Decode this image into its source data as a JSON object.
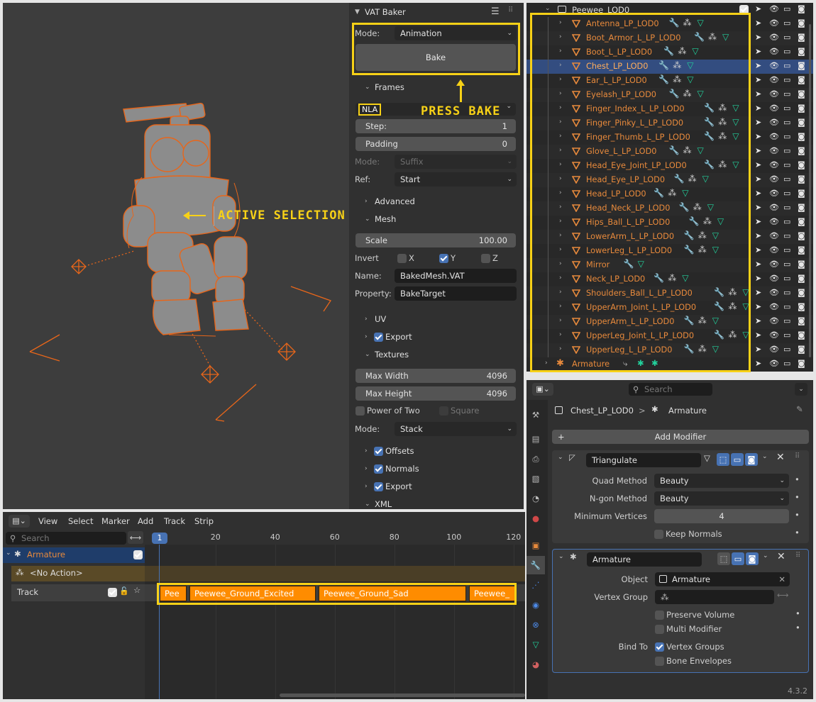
{
  "vat_baker": {
    "title": "VAT Baker",
    "mode_label": "Mode:",
    "mode_value": "Animation",
    "bake_button": "Bake",
    "frames_section": "Frames",
    "nla_tag": "NLA",
    "step_label": "Step:",
    "step_value": "1",
    "padding_label": "Padding",
    "padding_value": "0",
    "mode2_label": "Mode:",
    "mode2_value": "Suffix",
    "ref_label": "Ref:",
    "ref_value": "Start",
    "advanced_section": "Advanced",
    "mesh_section": "Mesh",
    "scale_label": "Scale",
    "scale_value": "100.00",
    "invert_label": "Invert",
    "invert_x": "X",
    "invert_y": "Y",
    "invert_z": "Z",
    "name_label": "Name:",
    "name_value": "BakedMesh.VAT",
    "property_label": "Property:",
    "property_value": "BakeTarget",
    "uv_section": "UV",
    "export_label": "Export",
    "textures_section": "Textures",
    "max_width_label": "Max Width",
    "max_width_value": "4096",
    "max_height_label": "Max Height",
    "max_height_value": "4096",
    "power_of_two_label": "Power of Two",
    "square_label": "Square",
    "tex_mode_label": "Mode:",
    "tex_mode_value": "Stack",
    "offsets_label": "Offsets",
    "normals_label": "Normals",
    "export2_label": "Export",
    "xml_section": "XML"
  },
  "annotations": {
    "press_bake": "PRESS BAKE",
    "active_selection": "ACTIVE SELECTION"
  },
  "outliner": {
    "collection": "Peewee_LOD0",
    "items": [
      {
        "name": "Antenna_LP_LOD0"
      },
      {
        "name": "Boot_Armor_L_LP_LOD0"
      },
      {
        "name": "Boot_L_LP_LOD0"
      },
      {
        "name": "Chest_LP_LOD0"
      },
      {
        "name": "Ear_L_LP_LOD0"
      },
      {
        "name": "Eyelash_LP_LOD0"
      },
      {
        "name": "Finger_Index_L_LP_LOD0"
      },
      {
        "name": "Finger_Pinky_L_LP_LOD0"
      },
      {
        "name": "Finger_Thumb_L_LP_LOD0"
      },
      {
        "name": "Glove_L_LP_LOD0"
      },
      {
        "name": "Head_Eye_Joint_LP_LOD0"
      },
      {
        "name": "Head_Eye_LP_LOD0"
      },
      {
        "name": "Head_LP_LOD0"
      },
      {
        "name": "Head_Neck_LP_LOD0"
      },
      {
        "name": "Hips_Ball_L_LP_LOD0"
      },
      {
        "name": "LowerArm_L_LP_LOD0"
      },
      {
        "name": "LowerLeg_L_LP_LOD0"
      },
      {
        "name": "Mirror"
      },
      {
        "name": "Neck_LP_LOD0"
      },
      {
        "name": "Shoulders_Ball_L_LP_LOD0"
      },
      {
        "name": "UpperArm_Joint_L_LP_LOD0"
      },
      {
        "name": "UpperArm_L_LP_LOD0"
      },
      {
        "name": "UpperLeg_Joint_L_LP_LOD0"
      },
      {
        "name": "UpperLeg_L_LP_LOD0"
      }
    ],
    "armature": "Armature",
    "selected_index": 3
  },
  "properties": {
    "search_placeholder": "Search",
    "breadcrumb_object": "Chest_LP_LOD0",
    "breadcrumb_sep": ">",
    "breadcrumb_modifier": "Armature",
    "add_modifier": "Add Modifier",
    "triangulate": {
      "name": "Triangulate",
      "quad_label": "Quad Method",
      "quad_value": "Beauty",
      "ngon_label": "N-gon Method",
      "ngon_value": "Beauty",
      "min_vertices_label": "Minimum Vertices",
      "min_vertices_value": "4",
      "keep_normals": "Keep Normals"
    },
    "armature_mod": {
      "name": "Armature",
      "object_label": "Object",
      "object_value": "Armature",
      "vgroup_label": "Vertex Group",
      "preserve_volume": "Preserve Volume",
      "multi_modifier": "Multi Modifier",
      "bind_to_label": "Bind To",
      "vertex_groups": "Vertex Groups",
      "bone_envelopes": "Bone Envelopes"
    },
    "version": "4.3.2"
  },
  "nla": {
    "menus": [
      "View",
      "Select",
      "Marker",
      "Add",
      "Track",
      "Strip"
    ],
    "search_placeholder": "Search",
    "current_frame": "1",
    "ruler": [
      "20",
      "40",
      "60",
      "80",
      "100",
      "120"
    ],
    "armature_track": "Armature",
    "no_action": "<No Action>",
    "track_label": "Track",
    "strips": [
      "Pee",
      "Peewee_Ground_Excited",
      "Peewee_Ground_Sad",
      "Peewee_"
    ]
  },
  "colors": {
    "accent_blue": "#4772b3",
    "object_orange": "#e88a3c",
    "strip_orange": "#fe8c00",
    "highlight_yellow": "#f7d117",
    "mesh_green": "#22d19c"
  }
}
